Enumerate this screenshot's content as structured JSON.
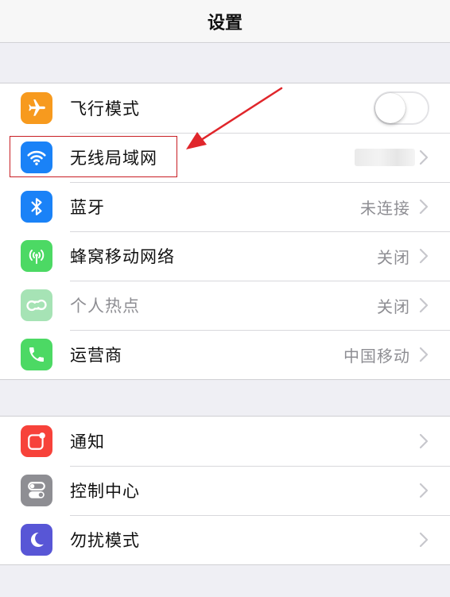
{
  "navbar": {
    "title": "设置"
  },
  "group1": {
    "items": [
      {
        "label": "飞行模式",
        "icon": "airplane-icon",
        "icon_color": "#f79a1e",
        "control": "toggle",
        "toggle_on": false
      },
      {
        "label": "无线局域网",
        "icon": "wifi-icon",
        "icon_color": "#1a82f7",
        "value": ""
      },
      {
        "label": "蓝牙",
        "icon": "bluetooth-icon",
        "icon_color": "#1a82f7",
        "value": "未连接"
      },
      {
        "label": "蜂窝移动网络",
        "icon": "cellular-antenna-icon",
        "icon_color": "#4cd964",
        "value": "关闭"
      },
      {
        "label": "个人热点",
        "icon": "hotspot-chain-icon",
        "icon_color": "#a6e3b5",
        "value": "关闭",
        "disabled": true
      },
      {
        "label": "运营商",
        "icon": "phone-icon",
        "icon_color": "#4cd964",
        "value": "中国移动"
      }
    ]
  },
  "group2": {
    "items": [
      {
        "label": "通知",
        "icon": "notification-icon",
        "icon_color": "#f7423a"
      },
      {
        "label": "控制中心",
        "icon": "control-switches-icon",
        "icon_color": "#8e8e93"
      },
      {
        "label": "勿扰模式",
        "icon": "moon-icon",
        "icon_color": "#5856d6"
      }
    ]
  },
  "annotation": {
    "highlight_color": "#c81e24"
  }
}
